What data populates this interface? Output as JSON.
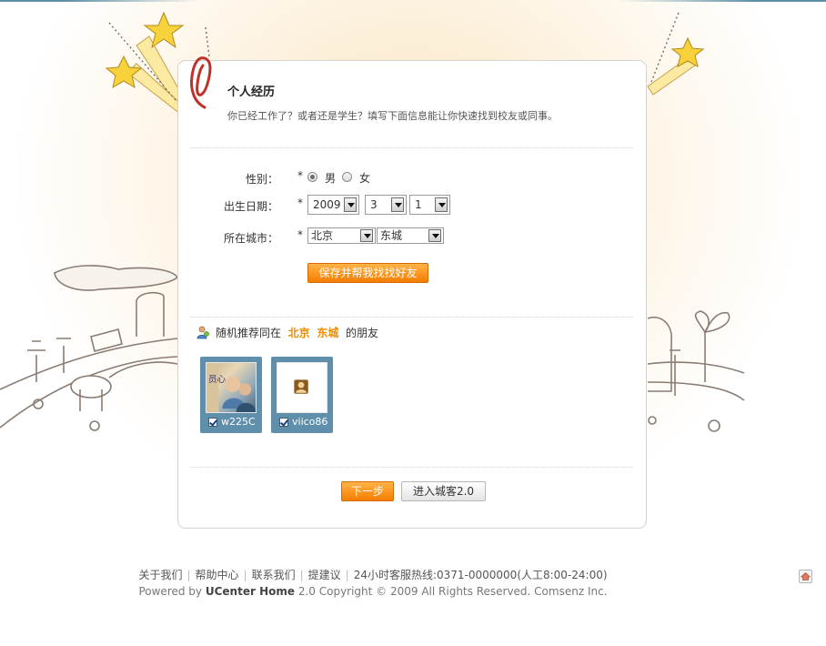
{
  "page": {
    "title": "个人经历",
    "description": "你已经工作了？或者还是学生？填写下面信息能让你快速找到校友或同事。"
  },
  "form": {
    "required_mark": "*",
    "gender": {
      "label": "性别：",
      "options": [
        "男",
        "女"
      ],
      "selected": "男"
    },
    "birthday": {
      "label": "出生日期：",
      "year": "2009",
      "month": "3",
      "day": "1"
    },
    "city": {
      "label": "所在城市：",
      "province": "北京",
      "district": "东城"
    },
    "save_button": "保存并帮我找找好友"
  },
  "recommend": {
    "prefix": "随机推荐同在",
    "province": "北京",
    "district": "东城",
    "suffix": "的朋友",
    "friends": [
      {
        "name": "w225C",
        "checked": true,
        "avatar_text": "员心"
      },
      {
        "name": "viico86",
        "checked": true
      }
    ]
  },
  "actions": {
    "next": "下一步",
    "enter": "进入城客2.0"
  },
  "footer": {
    "links": [
      "关于我们",
      "帮助中心",
      "联系我们",
      "提建议"
    ],
    "hotline": "24小时客服热线:0371-0000000(人工8:00-24:00)",
    "powered_prefix": "Powered by",
    "powered_brand": "UCenter Home",
    "powered_suffix": "2.0 Copyright © 2009 All Rights Reserved. Comsenz Inc."
  },
  "colors": {
    "accent_orange": "#f08c00",
    "friend_tile": "#5f8fab",
    "top_line": "#5a8fa6"
  }
}
